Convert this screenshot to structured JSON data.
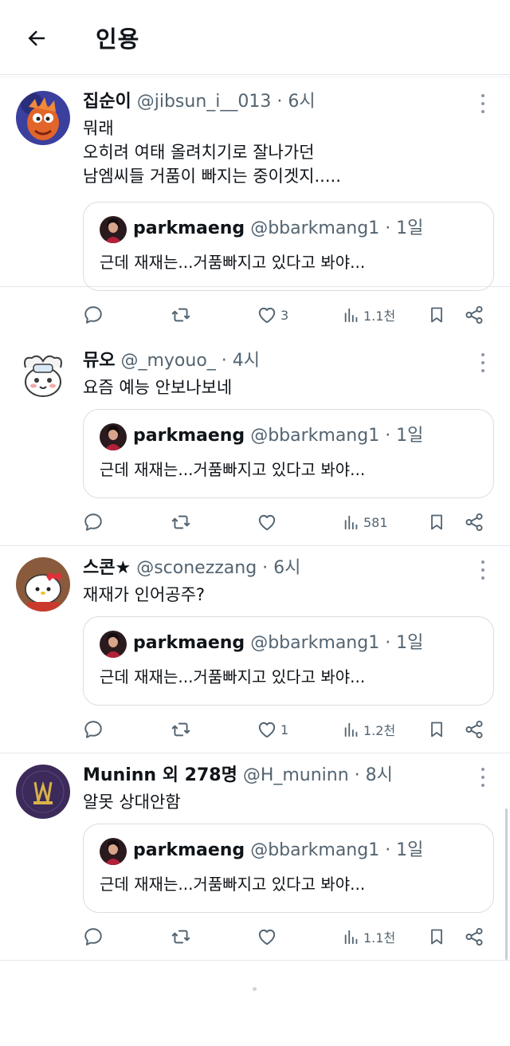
{
  "header": {
    "title": "인용"
  },
  "quoted": {
    "name": "parkmaeng",
    "meta": "@bbarkmang1 · 1일",
    "text": "근데 재재는...거품빠지고 있다고 봐야..."
  },
  "posts": [
    {
      "name": "집순이",
      "meta": "@jibsun_i__013 · 6시",
      "lines": [
        "뭐래",
        "오히려 여태 올려치기로 잘나가던",
        "남엠씨들 거품이 빠지는 중이겟지....."
      ],
      "likes": "3",
      "views": "1.1천"
    },
    {
      "name": "뮤오",
      "meta": "@_myouo_ · 4시",
      "lines": [
        "요즘 예능 안보나보네"
      ],
      "likes": "",
      "views": "581"
    },
    {
      "name": "스콘★",
      "meta": "@sconezzang · 6시",
      "lines": [
        "재재가 인어공주?"
      ],
      "likes": "1",
      "views": "1.2천"
    },
    {
      "name": "Muninn 외 278명",
      "meta": "@H_muninn · 8시",
      "lines": [
        "알못 상대안함"
      ],
      "likes": "",
      "views": "1.1천"
    }
  ],
  "icons": [
    "back-arrow-icon",
    "more-icon",
    "reply-icon",
    "repost-icon",
    "like-icon",
    "views-icon",
    "bookmark-icon",
    "share-icon"
  ],
  "colors": {
    "text": "#0f1419",
    "secondary": "#536471",
    "border": "#d9dee2"
  }
}
